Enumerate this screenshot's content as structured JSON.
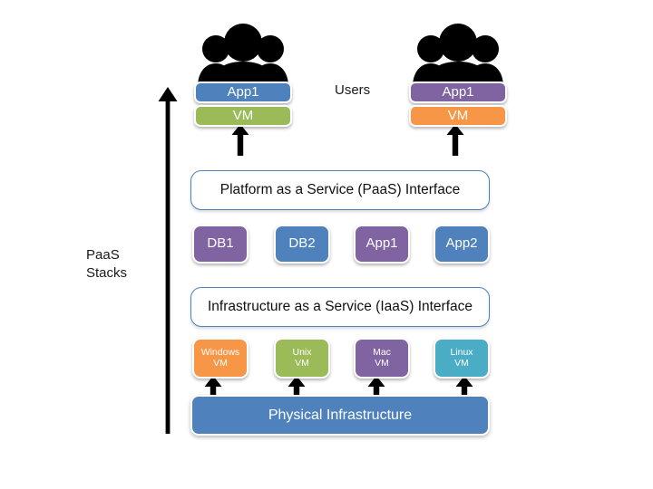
{
  "diagram": {
    "title": "PaaS / IaaS layered cloud stack diagram",
    "side_label": "PaaS\nStacks",
    "users_label": "Users"
  },
  "colors": {
    "blue": "#4f81bd",
    "green": "#9bbb59",
    "purple": "#8064a2",
    "orange": "#f79646",
    "teal": "#4bacc6",
    "outline_blue": "#4f81bd",
    "arrow_black": "#000000",
    "text_dark": "#1a1a1a",
    "white": "#ffffff"
  },
  "users": [
    {
      "icon": "people-group-icon",
      "app": {
        "label": "App1",
        "color": "#4f81bd"
      },
      "vm": {
        "label": "VM",
        "color": "#9bbb59"
      }
    },
    {
      "icon": "people-group-icon",
      "app": {
        "label": "App1",
        "color": "#8064a2"
      },
      "vm": {
        "label": "VM",
        "color": "#f79646"
      }
    }
  ],
  "interfaces": {
    "paas": "Platform as a Service (PaaS) Interface",
    "iaas": "Infrastructure as a Service (IaaS) Interface"
  },
  "paas_stacks": [
    {
      "label": "DB1",
      "color": "#8064a2"
    },
    {
      "label": "DB2",
      "color": "#4f81bd"
    },
    {
      "label": "App1",
      "color": "#8064a2"
    },
    {
      "label": "App2",
      "color": "#4f81bd"
    }
  ],
  "iaas_vms": [
    {
      "line1": "Windows",
      "line2": "VM",
      "color": "#f79646"
    },
    {
      "line1": "Unix",
      "line2": "VM",
      "color": "#9bbb59"
    },
    {
      "line1": "Mac",
      "line2": "VM",
      "color": "#8064a2"
    },
    {
      "line1": "Linux",
      "line2": "VM",
      "color": "#4bacc6"
    }
  ],
  "physical": {
    "label": "Physical Infrastructure",
    "color": "#4f81bd"
  },
  "arrows": {
    "vertical_axis": {
      "name": "paas-stacks-axis-arrow",
      "direction": "up"
    },
    "user_feeds": 2,
    "vm_feeds": 4
  }
}
